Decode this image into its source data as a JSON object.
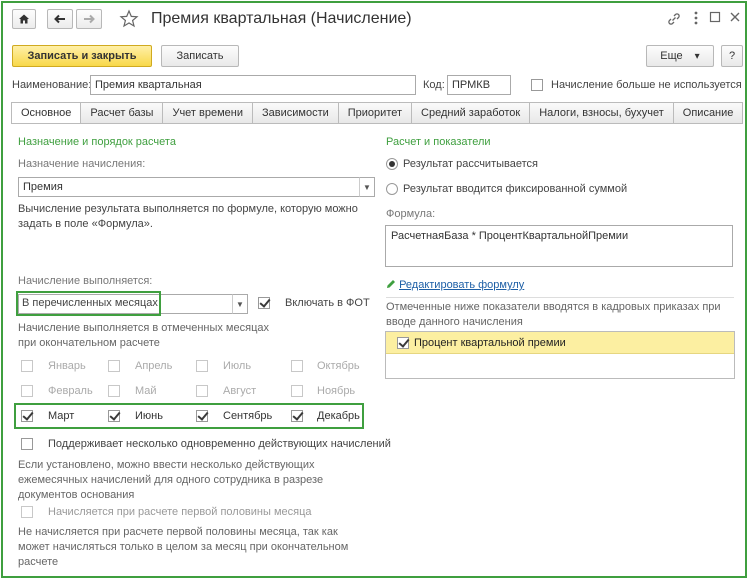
{
  "window": {
    "title": "Премия квартальная (Начисление)"
  },
  "toolbar": {
    "save_close": "Записать и закрыть",
    "save": "Записать",
    "more": "Еще",
    "more_arrow": "▾",
    "help": "?"
  },
  "header": {
    "name_label": "Наименование:",
    "name_value": "Премия квартальная",
    "code_label": "Код:",
    "code_value": "ПРМКВ",
    "unused_label": "Начисление больше не используется"
  },
  "tabs": [
    {
      "label": "Основное"
    },
    {
      "label": "Расчет базы"
    },
    {
      "label": "Учет времени"
    },
    {
      "label": "Зависимости"
    },
    {
      "label": "Приоритет"
    },
    {
      "label": "Средний заработок"
    },
    {
      "label": "Налоги, взносы, бухучет"
    },
    {
      "label": "Описание"
    }
  ],
  "left": {
    "section_title": "Назначение и порядок расчета",
    "purpose_label": "Назначение начисления:",
    "purpose_value": "Премия",
    "formula_desc": "Вычисление результата выполняется по формуле, которую можно задать в поле «Формула».",
    "performed_label": "Начисление выполняется:",
    "performed_value": "В перечисленных месяцах",
    "include_fot": "Включать в ФОТ",
    "months_desc": "Начисление выполняется в отмеченных месяцах при окончательном расчете",
    "months": [
      {
        "label": "Январь",
        "checked": false,
        "disabled": true
      },
      {
        "label": "Апрель",
        "checked": false,
        "disabled": true
      },
      {
        "label": "Июль",
        "checked": false,
        "disabled": true
      },
      {
        "label": "Октябрь",
        "checked": false,
        "disabled": true
      },
      {
        "label": "Февраль",
        "checked": false,
        "disabled": true
      },
      {
        "label": "Май",
        "checked": false,
        "disabled": true
      },
      {
        "label": "Август",
        "checked": false,
        "disabled": true
      },
      {
        "label": "Ноябрь",
        "checked": false,
        "disabled": true
      },
      {
        "label": "Март",
        "checked": true,
        "disabled": false
      },
      {
        "label": "Июнь",
        "checked": true,
        "disabled": false
      },
      {
        "label": "Сентябрь",
        "checked": true,
        "disabled": false
      },
      {
        "label": "Декабрь",
        "checked": true,
        "disabled": false
      }
    ],
    "multi_label": "Поддерживает несколько одновременно действующих начислений",
    "multi_desc": "Если установлено, можно ввести несколько действующих ежемесячных начислений для одного сотрудника в разрезе документов основания",
    "first_half_label": "Начисляется при расчете первой половины месяца",
    "first_half_desc": "Не начисляется при расчете первой половины месяца, так как может начисляться только в целом за месяц при окончательном расчете"
  },
  "right": {
    "section_title": "Расчет и показатели",
    "radio_calc": "Результат рассчитывается",
    "radio_fixed": "Результат вводится фиксированной суммой",
    "formula_label": "Формула:",
    "formula_value": "РасчетнаяБаза * ПроцентКвартальнойПремии",
    "edit_formula": "Редактировать формулу",
    "indicators_desc": "Отмеченные ниже показатели вводятся в кадровых приказах при вводе данного начисления",
    "indicator_item": "Процент квартальной премии"
  },
  "colors": {
    "accent_green": "#3f9f3f",
    "primary_yellow": "#f8d84a",
    "highlight_row": "#fcefa1",
    "link_blue": "#1d5fa6"
  }
}
